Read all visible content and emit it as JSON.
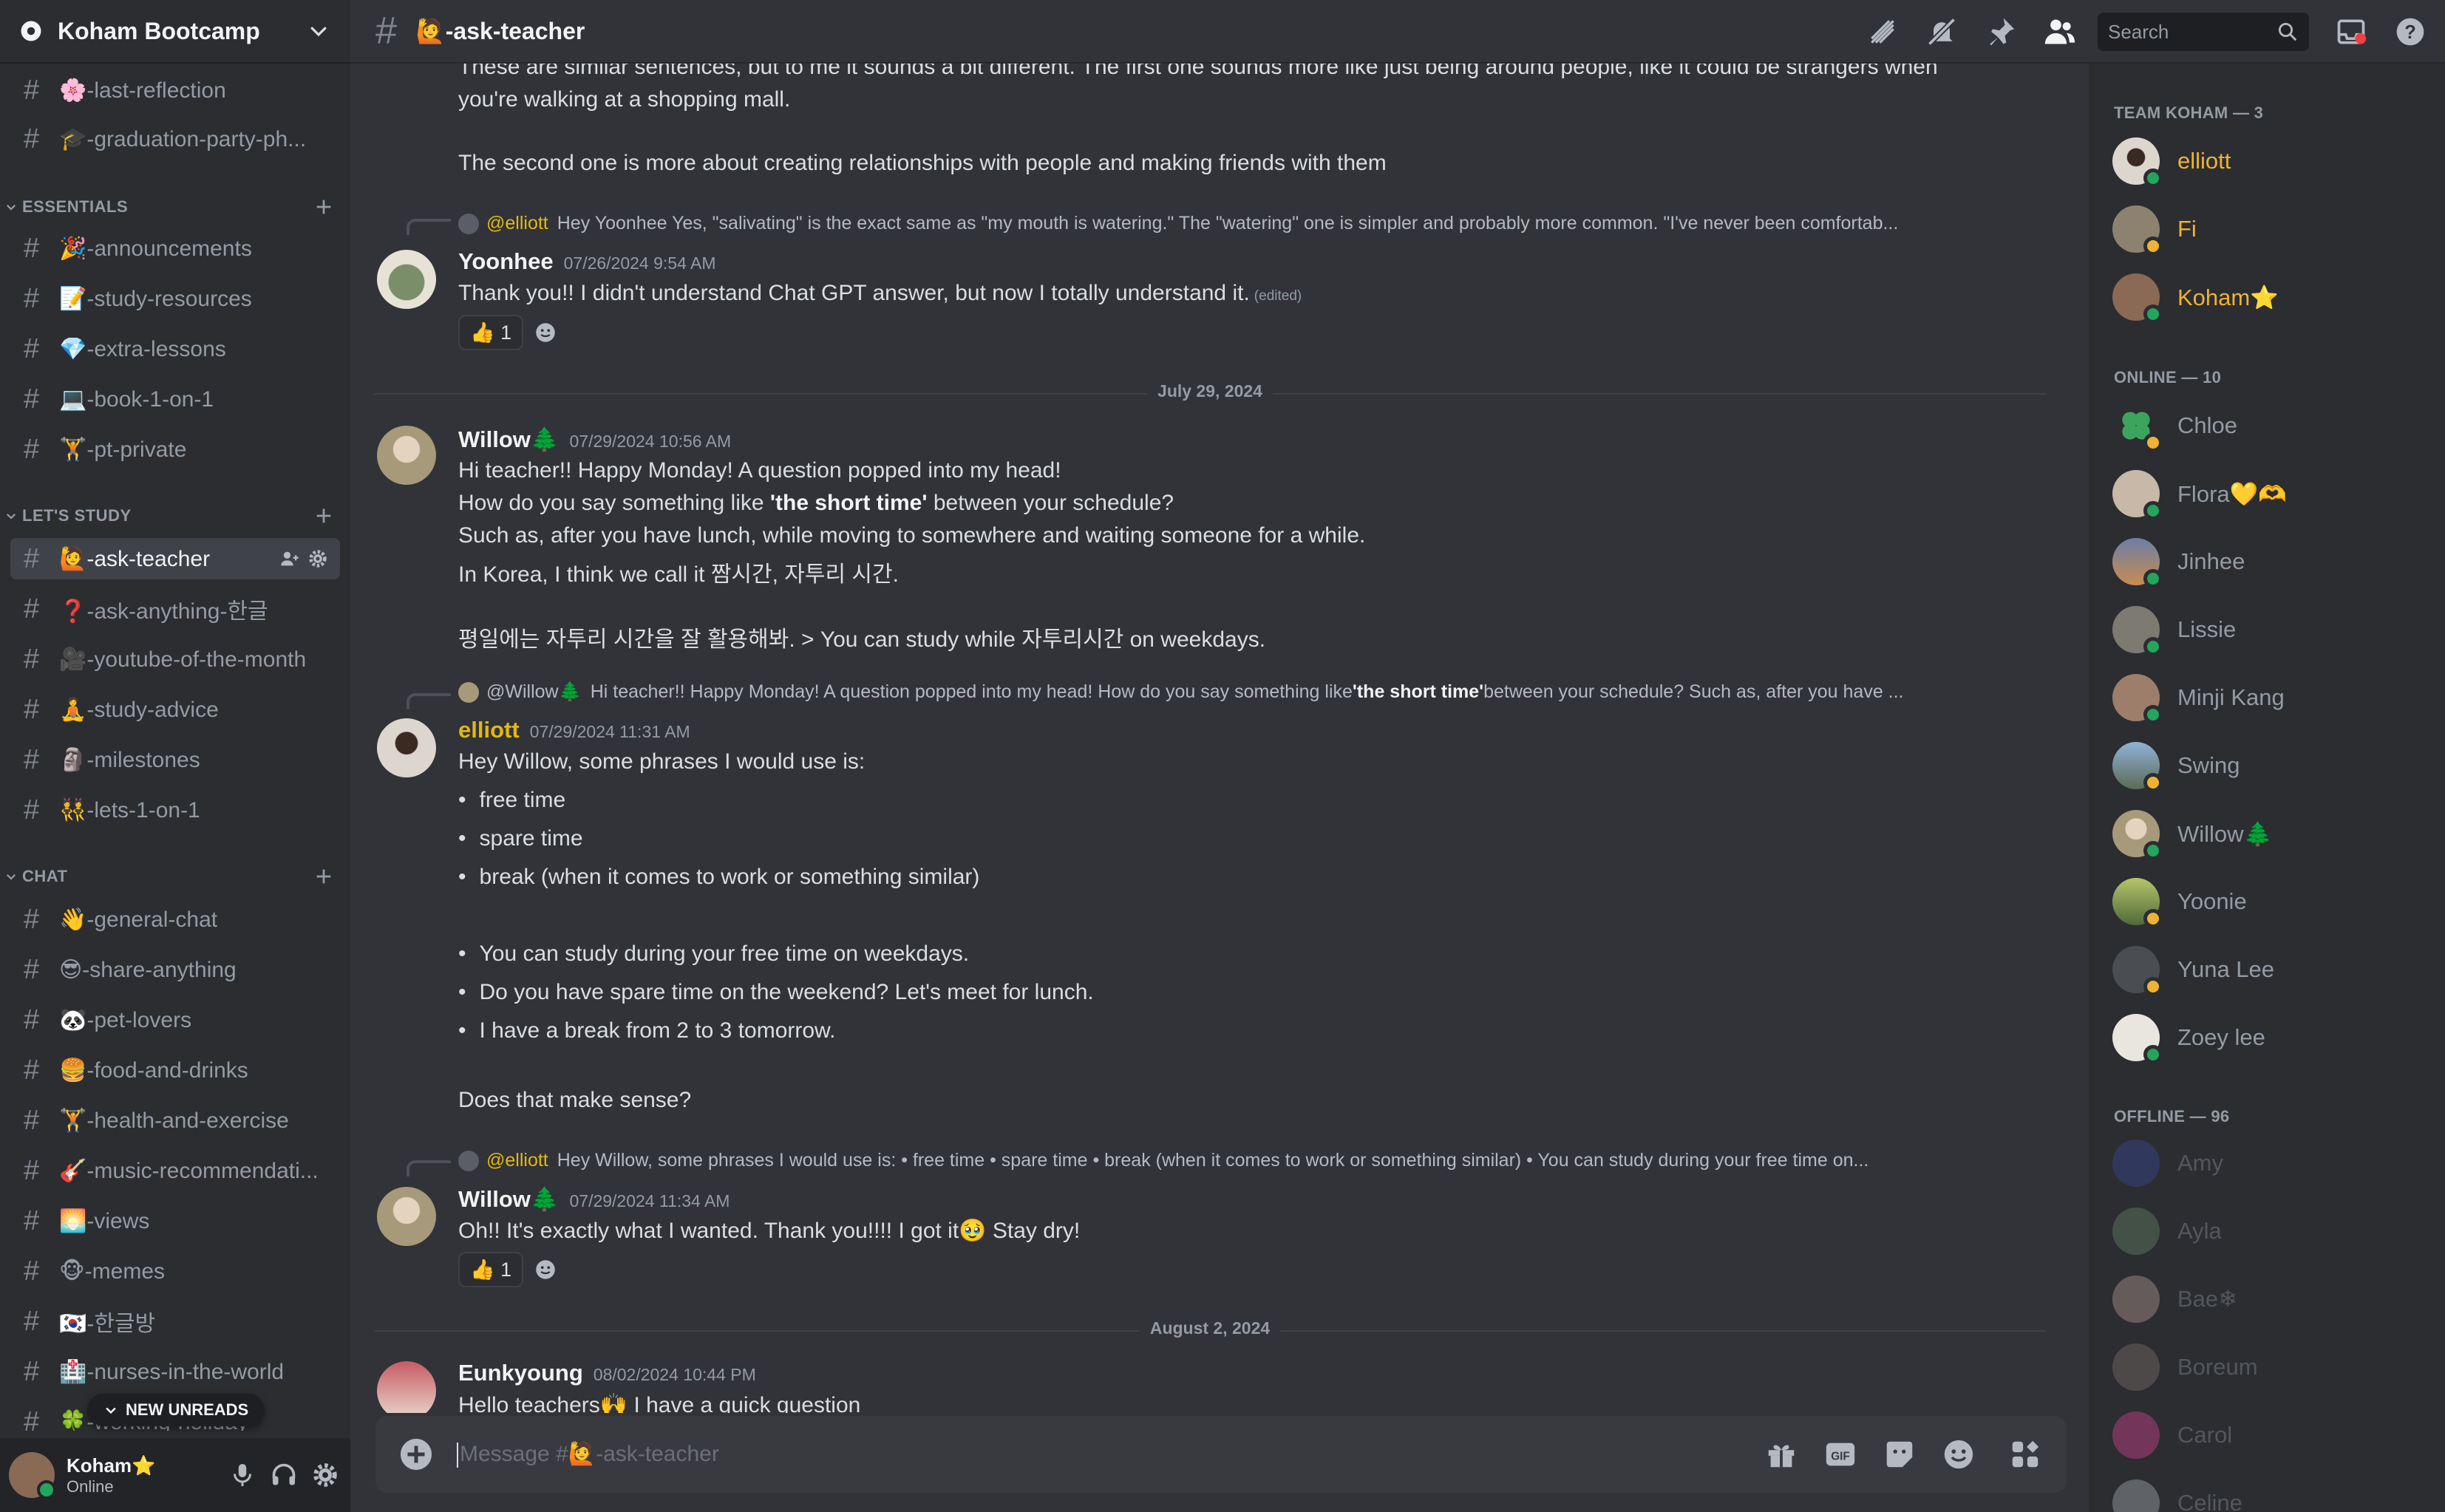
{
  "server": {
    "name": "Koham Bootcamp"
  },
  "channel": {
    "name": "🙋-ask-teacher"
  },
  "search": {
    "placeholder": "Search"
  },
  "channels_top": [
    {
      "label": "🌸-last-reflection"
    },
    {
      "label": "🎓-graduation-party-ph..."
    }
  ],
  "categories": {
    "essentials": "ESSENTIALS",
    "lets_study": "LET'S STUDY",
    "chat": "CHAT"
  },
  "essentials": [
    {
      "label": "🎉-announcements"
    },
    {
      "label": "📝-study-resources"
    },
    {
      "label": "💎-extra-lessons"
    },
    {
      "label": "💻-book-1-on-1"
    },
    {
      "label": "🏋-pt-private"
    }
  ],
  "study": [
    {
      "label": "🙋-ask-teacher"
    },
    {
      "label": "❓-ask-anything-한글"
    },
    {
      "label": "🎥-youtube-of-the-month"
    },
    {
      "label": "🧘-study-advice"
    },
    {
      "label": "🗿-milestones"
    },
    {
      "label": "👯-lets-1-on-1"
    }
  ],
  "chat": [
    {
      "label": "👋-general-chat"
    },
    {
      "label": "😎-share-anything"
    },
    {
      "label": "🐼-pet-lovers"
    },
    {
      "label": "🍔-food-and-drinks"
    },
    {
      "label": "🏋-health-and-exercise"
    },
    {
      "label": "🎸-music-recommendati..."
    },
    {
      "label": "🌅-views"
    },
    {
      "label": "🐵-memes"
    },
    {
      "label": "🇰🇷-한글방"
    },
    {
      "label": "🏥-nurses-in-the-world"
    },
    {
      "label": "🍀-working-holiday"
    }
  ],
  "new_unreads": "NEW UNREADS",
  "user_panel": {
    "name": "Koham⭐",
    "status": "Online"
  },
  "messages": {
    "m0_line1": "These are similar sentences, but to me it sounds a bit different. The first one sounds more like just being around people, like it could be strangers when",
    "m0_line2": "you're walking at a shopping mall.",
    "m0_line3": "The second one is more about creating relationships with people and making friends with them",
    "m1_reply_name": "@elliott",
    "m1_reply_text": "Hey Yoonhee  Yes, \"salivating\" is the exact same as \"my mouth is watering.\" The \"watering\" one is simpler and probably more common.  \"I've never been comfortab...",
    "m1_user": "Yoonhee",
    "m1_time": "07/26/2024 9:54 AM",
    "m1_text": "Thank you!! I didn't understand Chat GPT answer, but now I totally understand it.",
    "m1_edited": "(edited)",
    "m1_reaction": "👍 1",
    "date1": "July 29, 2024",
    "m2_user": "Willow🌲",
    "m2_time": "07/29/2024 10:56 AM",
    "m2_l1": "Hi teacher!! Happy Monday! A question popped into my head!",
    "m2_l2a": "How do you say something like ",
    "m2_l2b": "'the short time'",
    "m2_l2c": " between your schedule?",
    "m2_l3": "Such as, after you have lunch, while moving to somewhere and waiting someone for a while.",
    "m2_l4": "In Korea, I think we call it 짬시간, 자투리 시간.",
    "m2_l5": "평일에는 자투리 시간을 잘 활용해봐. > You can study while 자투리시간 on weekdays.",
    "m3_reply_name": "@Willow🌲",
    "m3_reply_a": "Hi teacher!! Happy Monday! A question popped into my head!  How do you say something like ",
    "m3_reply_b": "'the short time'",
    "m3_reply_c": " between your schedule?  Such as, after you have ...",
    "m3_user": "elliott",
    "m3_time": "07/29/2024 11:31 AM",
    "m3_l1": "Hey Willow, some phrases I would use is:",
    "m3_b1": "free time",
    "m3_b2": "spare time",
    "m3_b3": "break (when it comes to work or something similar)",
    "m3_b4": "You can study during your free time on weekdays.",
    "m3_b5": "Do you have spare time on the weekend? Let's meet for lunch.",
    "m3_b6": "I have a break from 2 to 3 tomorrow.",
    "m3_l2": "Does that make sense?",
    "m4_reply_name": "@elliott",
    "m4_reply_text": "Hey Willow, some phrases I would use is: • free time  • spare time  • break (when it comes to work or something similar)     • You can study during your free time on...",
    "m4_user": "Willow🌲",
    "m4_time": "07/29/2024 11:34 AM",
    "m4_text": "Oh!! It's exactly what I wanted. Thank you!!!! I got it🥹  Stay dry!",
    "m4_reaction": "👍 1",
    "date2": "August 2, 2024",
    "m5_user": "Eunkyoung",
    "m5_time": "08/02/2024 10:44 PM",
    "m5_text": "Hello teachers🙌  I have a quick question"
  },
  "composer": {
    "placeholder": "Message #🙋-ask-teacher"
  },
  "members": {
    "team_header": "TEAM KOHAM — 3",
    "team": [
      "elliott",
      "Fi",
      "Koham⭐"
    ],
    "online_header": "ONLINE — 10",
    "online": [
      "Chloe",
      "Flora💛🫶",
      "Jinhee",
      "Lissie",
      "Minji Kang",
      "Swing",
      "Willow🌲",
      "Yoonie",
      "Yuna Lee",
      "Zoey lee"
    ],
    "offline_header": "OFFLINE — 96",
    "offline": [
      "Amy",
      "Ayla",
      "Bae❄",
      "Boreum",
      "Carol",
      "Celine"
    ]
  },
  "colors": {
    "accent_yellow": "#f0b232",
    "online_green": "#23a55a",
    "delete_red": "#f23f42"
  },
  "icons": [
    "gear-icon",
    "chevron-down-icon",
    "hash-icon",
    "plus-icon",
    "threads-icon",
    "mute-icon",
    "pin-icon",
    "members-icon",
    "search-icon",
    "inbox-icon",
    "help-icon",
    "mic-icon",
    "headphones-icon",
    "link-icon",
    "emoji-icon",
    "reply-icon",
    "trash-icon",
    "gift-icon",
    "gif-icon",
    "sticker-icon",
    "apps-icon"
  ]
}
